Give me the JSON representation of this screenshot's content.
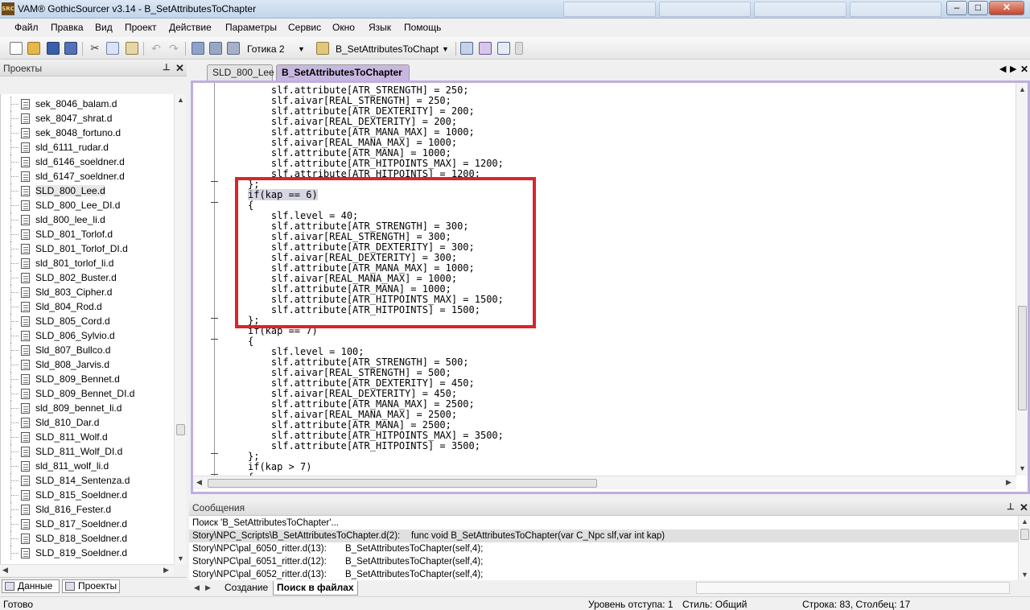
{
  "window": {
    "title": "VAM® GothicSourcer v3.14 - B_SetAttributesToChapter",
    "app_icon_text": "SRC"
  },
  "window_buttons": {
    "minimize": "–",
    "restore": "□",
    "close": "✕"
  },
  "menu": [
    "Файл",
    "Правка",
    "Вид",
    "Проект",
    "Действие",
    "Параметры",
    "Сервис",
    "Окно",
    "Язык",
    "Помощь"
  ],
  "toolbar": {
    "game_combo": "Готика 2",
    "func_combo": "B_SetAttributesToChapt"
  },
  "projects_panel": {
    "title": "Проекты",
    "pin": "📌",
    "close": "✕",
    "files": [
      "sek_8046_balam.d",
      "sek_8047_shrat.d",
      "sek_8048_fortuno.d",
      "sld_6111_rudar.d",
      "sld_6146_soeldner.d",
      "sld_6147_soeldner.d",
      "SLD_800_Lee.d",
      "SLD_800_Lee_DI.d",
      "sld_800_lee_li.d",
      "SLD_801_Torlof.d",
      "SLD_801_Torlof_DI.d",
      "sld_801_torlof_li.d",
      "SLD_802_Buster.d",
      "Sld_803_Cipher.d",
      "Sld_804_Rod.d",
      "SLD_805_Cord.d",
      "SLD_806_Sylvio.d",
      "Sld_807_Bullco.d",
      "Sld_808_Jarvis.d",
      "SLD_809_Bennet.d",
      "SLD_809_Bennet_DI.d",
      "sld_809_bennet_li.d",
      "Sld_810_Dar.d",
      "SLD_811_Wolf.d",
      "SLD_811_Wolf_DI.d",
      "sld_811_wolf_li.d",
      "SLD_814_Sentenza.d",
      "SLD_815_Soeldner.d",
      "Sld_816_Fester.d",
      "SLD_817_Soeldner.d",
      "SLD_818_Soeldner.d",
      "SLD_819_Soeldner.d"
    ],
    "selected_index": 6,
    "bottom_tabs": [
      "Данные",
      "Проекты"
    ]
  },
  "doc_tabs": [
    "SLD_800_Lee",
    "B_SetAttributesToChapter"
  ],
  "code_lines": [
    "    slf.attribute[ATR_STRENGTH] = 250;",
    "    slf.aivar[REAL_STRENGTH] = 250;",
    "    slf.attribute[ATR_DEXTERITY] = 200;",
    "    slf.aivar[REAL_DEXTERITY] = 200;",
    "    slf.attribute[ATR_MANA_MAX] = 1000;",
    "    slf.aivar[REAL_MANA_MAX] = 1000;",
    "    slf.attribute[ATR_MANA] = 1000;",
    "    slf.attribute[ATR_HITPOINTS_MAX] = 1200;",
    "    slf.attribute[ATR_HITPOINTS] = 1200;",
    "};",
    "if(kap == 6)",
    "{",
    "    slf.level = 40;",
    "    slf.attribute[ATR_STRENGTH] = 300;",
    "    slf.aivar[REAL_STRENGTH] = 300;",
    "    slf.attribute[ATR_DEXTERITY] = 300;",
    "    slf.aivar[REAL_DEXTERITY] = 300;",
    "    slf.attribute[ATR_MANA_MAX] = 1000;",
    "    slf.aivar[REAL_MANA_MAX] = 1000;",
    "    slf.attribute[ATR_MANA] = 1000;",
    "    slf.attribute[ATR_HITPOINTS_MAX] = 1500;",
    "    slf.attribute[ATR_HITPOINTS] = 1500;",
    "};",
    "if(kap == 7)",
    "{",
    "    slf.level = 100;",
    "    slf.attribute[ATR_STRENGTH] = 500;",
    "    slf.aivar[REAL_STRENGTH] = 500;",
    "    slf.attribute[ATR_DEXTERITY] = 450;",
    "    slf.aivar[REAL_DEXTERITY] = 450;",
    "    slf.attribute[ATR_MANA_MAX] = 2500;",
    "    slf.aivar[REAL_MANA_MAX] = 2500;",
    "    slf.attribute[ATR_MANA] = 2500;",
    "    slf.attribute[ATR_HITPOINTS_MAX] = 3500;",
    "    slf.attribute[ATR_HITPOINTS] = 3500;",
    "};",
    "if(kap > 7)",
    "{"
  ],
  "highlighted_line_index": 10,
  "messages_panel": {
    "title": "Сообщения",
    "lines": [
      {
        "file": "Поиск 'B_SetAttributesToChapter'...",
        "text": ""
      },
      {
        "file": "Story\\NPC_Scripts\\B_SetAttributesToChapter.d(2):",
        "text": "func void B_SetAttributesToChapter(var C_Npc slf,var int kap)"
      },
      {
        "file": "Story\\NPC\\pal_6050_ritter.d(13):",
        "text": "B_SetAttributesToChapter(self,4);"
      },
      {
        "file": "Story\\NPC\\pal_6051_ritter.d(12):",
        "text": "B_SetAttributesToChapter(self,4);"
      },
      {
        "file": "Story\\NPC\\pal_6052_ritter.d(13):",
        "text": "B_SetAttributesToChapter(self,4);"
      }
    ],
    "selected_index": 1,
    "tabs": [
      "Создание",
      "Поиск в файлах"
    ]
  },
  "status": {
    "left": "Готово",
    "indent": "Уровень отступа: 1",
    "style": "Стиль: Общий",
    "position": "Строка: 83, Столбец: 17"
  },
  "colors": {
    "accent_tab": "#c8b8e0",
    "highlight_box": "#d9252a",
    "number": "#0a7c7c"
  }
}
